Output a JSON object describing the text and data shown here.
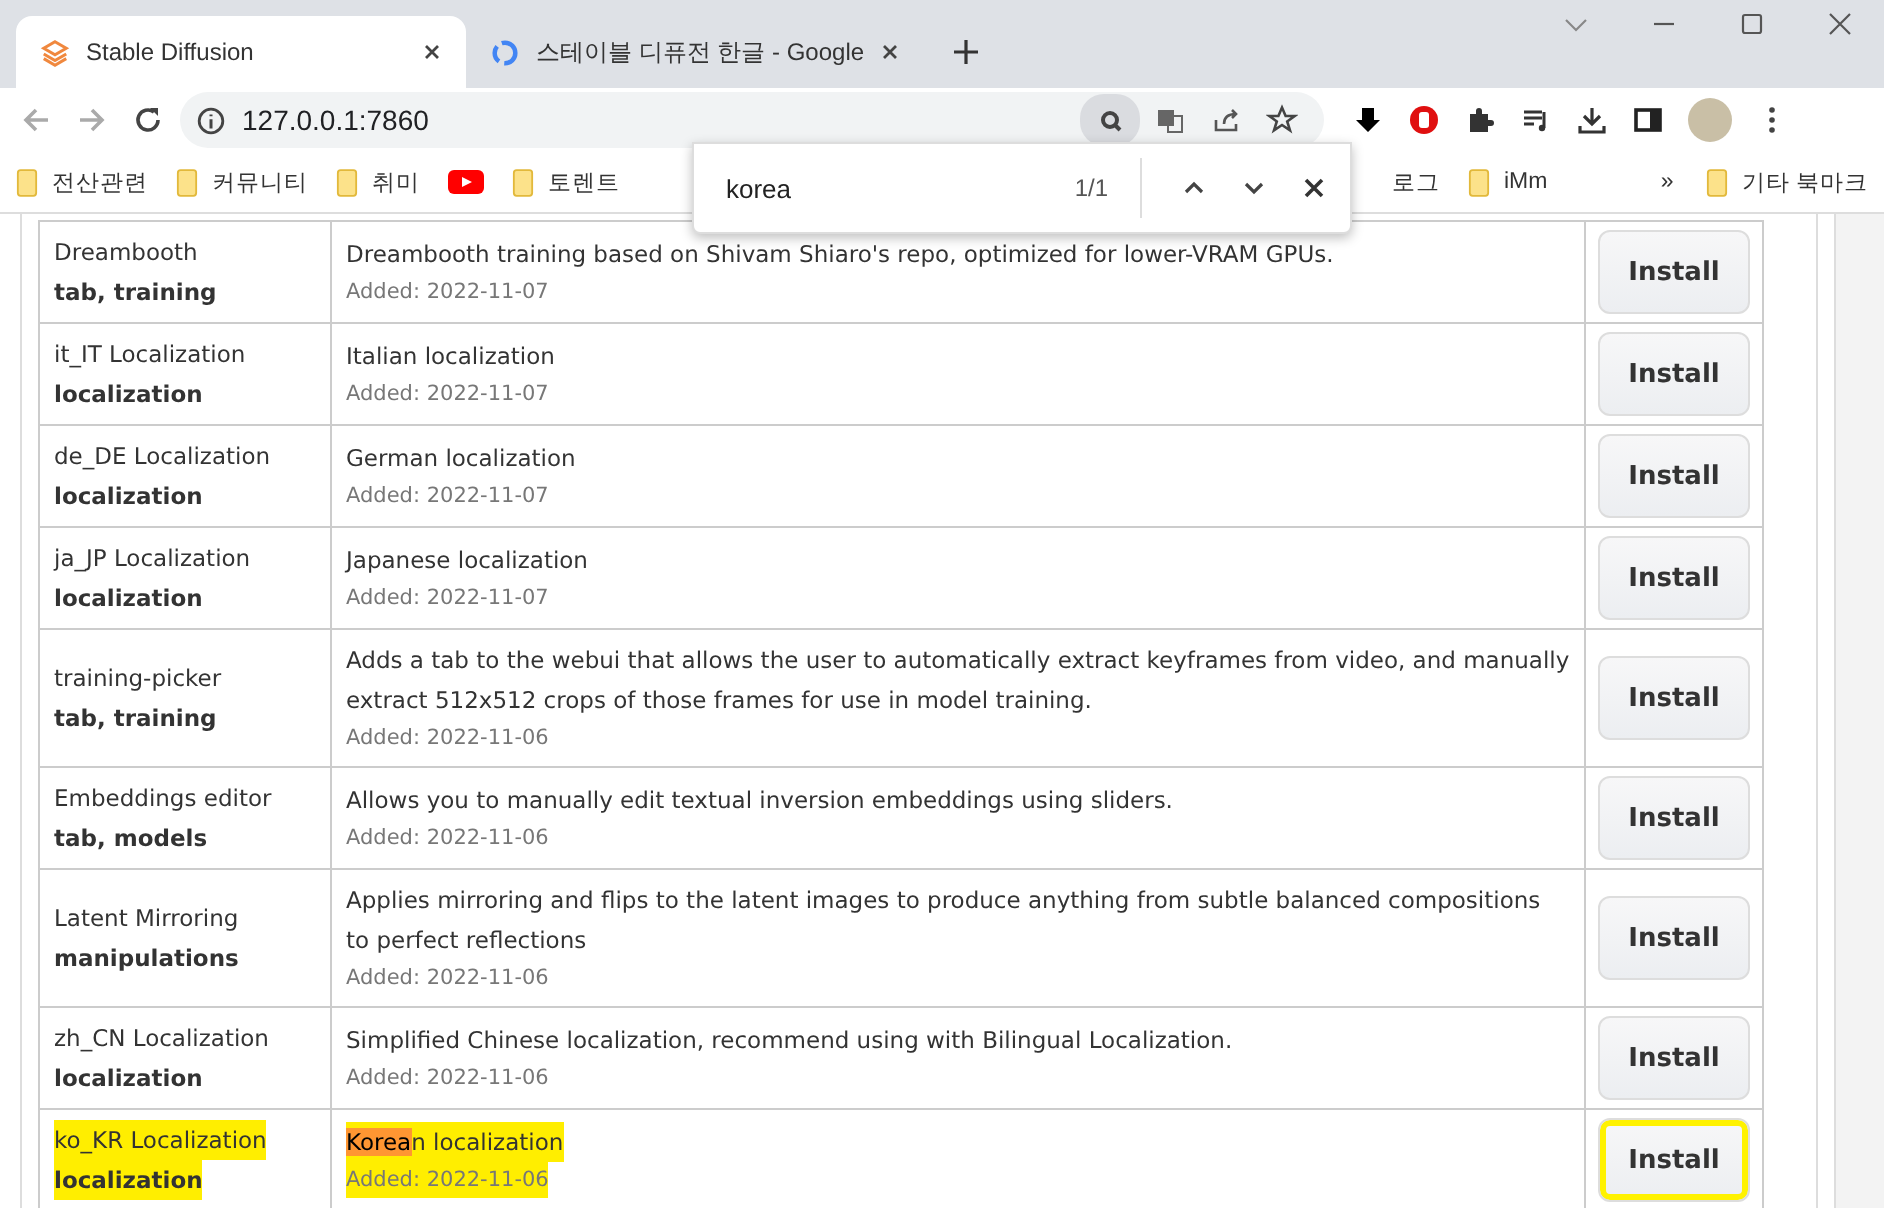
{
  "tabs": [
    {
      "title": "Stable Diffusion",
      "selected": true
    },
    {
      "title": "스테이블 디퓨전 한글 - Google",
      "selected": false
    }
  ],
  "address": "127.0.0.1:7860",
  "bookmarks": [
    {
      "label": "전산관련",
      "kind": "folder"
    },
    {
      "label": "커뮤니티",
      "kind": "folder"
    },
    {
      "label": "취미",
      "kind": "folder"
    },
    {
      "kind": "youtube"
    },
    {
      "label": "토렌트",
      "kind": "folder"
    },
    {
      "label": "로그",
      "kind": "text"
    },
    {
      "label": "iMm",
      "kind": "folder"
    }
  ],
  "bookmarks_overflow": "»",
  "other_bookmarks": "기타 북마크",
  "find": {
    "query": "korea",
    "count": "1/1"
  },
  "rows": [
    {
      "name": "Dreambooth",
      "tags": "tab, training",
      "description": "Dreambooth training based on Shivam Shiaro's repo, optimized for lower-VRAM GPUs.",
      "added": "Added: 2022-11-07",
      "button": "Install",
      "highlighted": false
    },
    {
      "name": "it_IT Localization",
      "tags": "localization",
      "description": "Italian localization",
      "added": "Added: 2022-11-07",
      "button": "Install",
      "highlighted": false
    },
    {
      "name": "de_DE Localization",
      "tags": "localization",
      "description": "German localization",
      "added": "Added: 2022-11-07",
      "button": "Install",
      "highlighted": false
    },
    {
      "name": "ja_JP Localization",
      "tags": "localization",
      "description": "Japanese localization",
      "added": "Added: 2022-11-07",
      "button": "Install",
      "highlighted": false
    },
    {
      "name": "training-picker",
      "tags": "tab, training",
      "description": "Adds a tab to the webui that allows the user to automatically extract keyframes from video, and manually extract 512x512 crops of those frames for use in model training.",
      "added": "Added: 2022-11-06",
      "button": "Install",
      "highlighted": false
    },
    {
      "name": "Embeddings editor",
      "tags": "tab, models",
      "description": "Allows you to manually edit textual inversion embeddings using sliders.",
      "added": "Added: 2022-11-06",
      "button": "Install",
      "highlighted": false
    },
    {
      "name": "Latent Mirroring",
      "tags": "manipulations",
      "description": "Applies mirroring and flips to the latent images to produce anything from subtle balanced compositions to perfect reflections",
      "added": "Added: 2022-11-06",
      "button": "Install",
      "highlighted": false
    },
    {
      "name": "zh_CN Localization",
      "tags": "localization",
      "description": "Simplified Chinese localization, recommend using with Bilingual Localization.",
      "added": "Added: 2022-11-06",
      "button": "Install",
      "highlighted": false
    },
    {
      "name": "ko_KR Localization",
      "tags": "localization",
      "find_match": "Korea",
      "description": "n localization",
      "added": "Added: 2022-11-06",
      "button": "Install",
      "highlighted": true
    }
  ]
}
